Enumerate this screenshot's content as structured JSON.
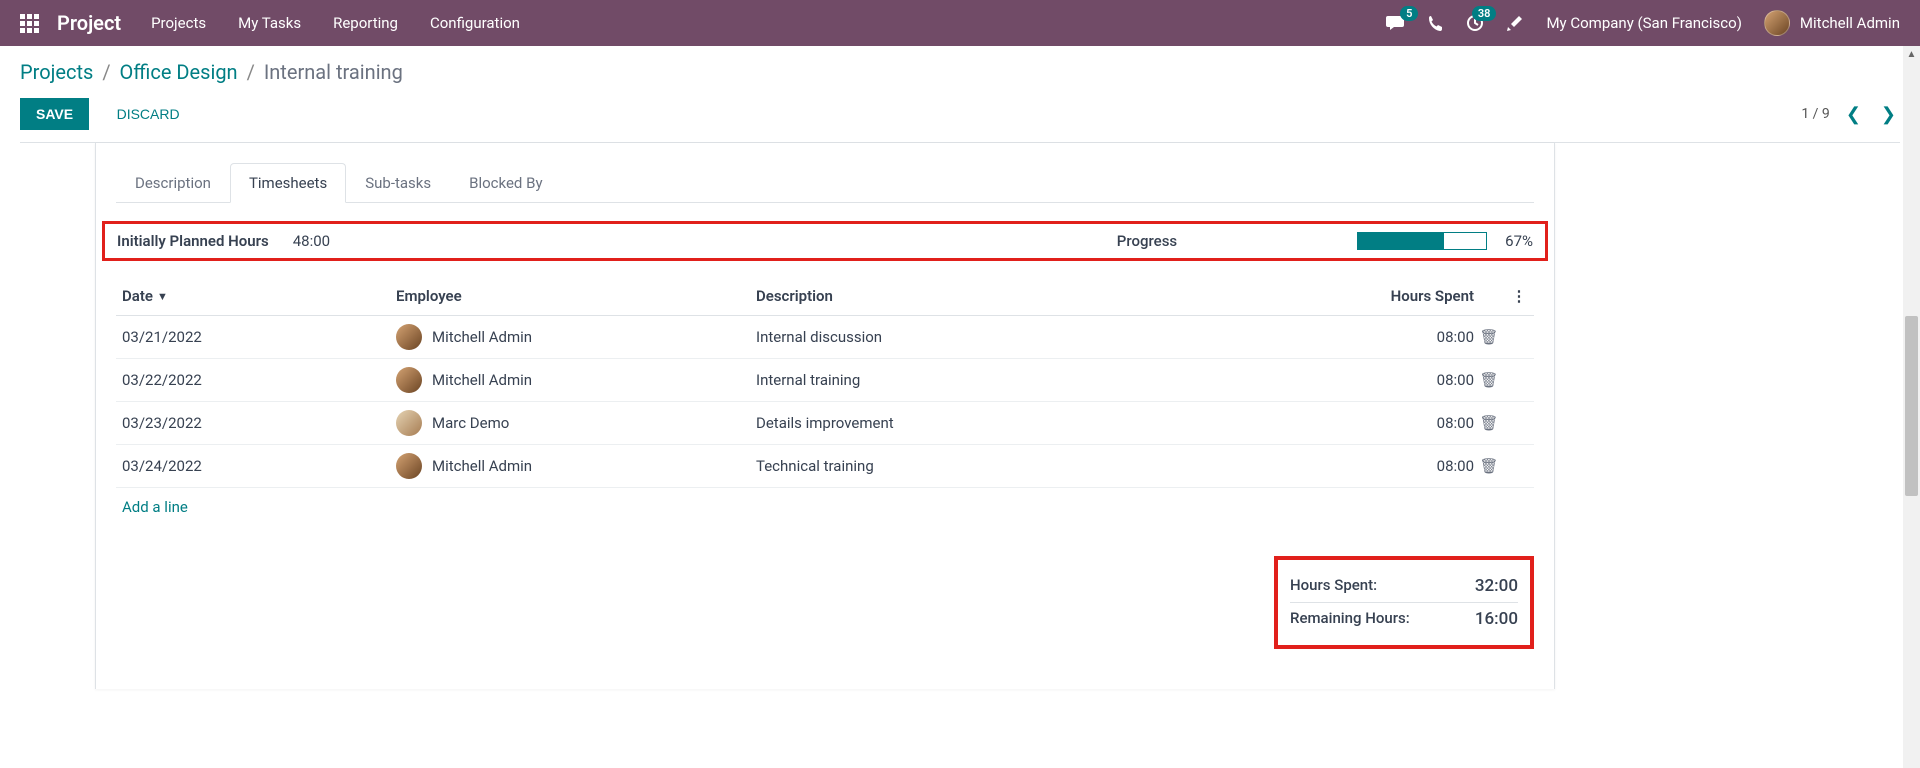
{
  "topbar": {
    "app_name": "Project",
    "menu": [
      "Projects",
      "My Tasks",
      "Reporting",
      "Configuration"
    ],
    "badge_messages": "5",
    "badge_activities": "38",
    "company": "My Company (San Francisco)",
    "user": "Mitchell Admin"
  },
  "breadcrumb": {
    "root": "Projects",
    "project": "Office Design",
    "task": "Internal training"
  },
  "buttons": {
    "save": "SAVE",
    "discard": "DISCARD"
  },
  "pager": {
    "text": "1 / 9"
  },
  "tabs": [
    "Description",
    "Timesheets",
    "Sub-tasks",
    "Blocked By"
  ],
  "active_tab": 1,
  "planned": {
    "label": "Initially Planned Hours",
    "value": "48:00",
    "progress_label": "Progress",
    "progress_pct": "67%",
    "progress_fill": 67
  },
  "table": {
    "headers": {
      "date": "Date",
      "employee": "Employee",
      "description": "Description",
      "hours": "Hours Spent"
    },
    "rows": [
      {
        "date": "03/21/2022",
        "employee": "Mitchell Admin",
        "avatar": "av1",
        "description": "Internal discussion",
        "hours": "08:00"
      },
      {
        "date": "03/22/2022",
        "employee": "Mitchell Admin",
        "avatar": "av1",
        "description": "Internal training",
        "hours": "08:00"
      },
      {
        "date": "03/23/2022",
        "employee": "Marc Demo",
        "avatar": "av2",
        "description": "Details improvement",
        "hours": "08:00"
      },
      {
        "date": "03/24/2022",
        "employee": "Mitchell Admin",
        "avatar": "av1",
        "description": "Technical training",
        "hours": "08:00"
      }
    ],
    "add_line": "Add a line"
  },
  "totals": {
    "spent_label": "Hours Spent:",
    "spent_value": "32:00",
    "remaining_label": "Remaining Hours:",
    "remaining_value": "16:00"
  }
}
